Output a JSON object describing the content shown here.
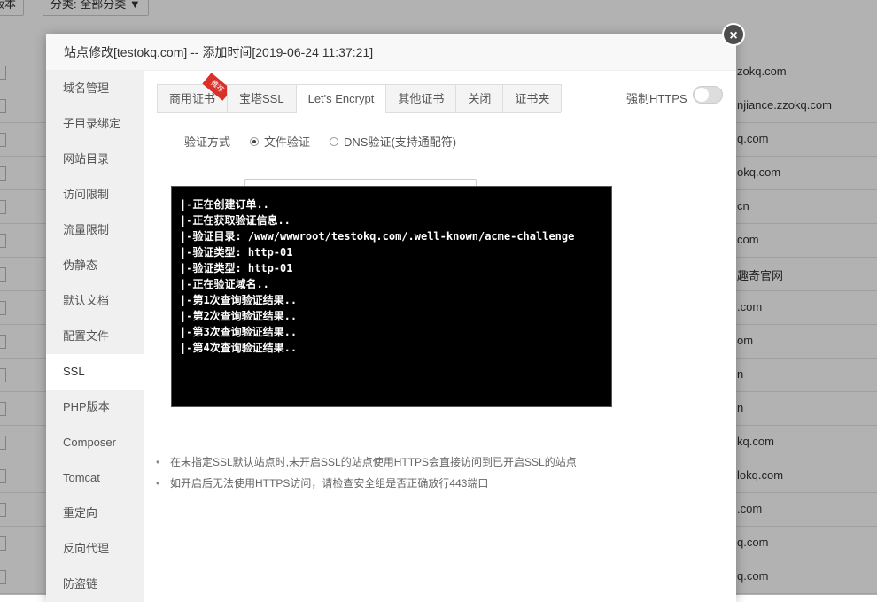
{
  "background": {
    "top_buttons": [
      "行版本",
      "分类: 全部分类 ▼"
    ],
    "row_sites": [
      "zokq.com",
      "njiance.zzokq.com",
      "q.com",
      "okq.com",
      "cn",
      "com",
      "趣奇官网",
      ".com",
      "om",
      "n",
      "n",
      "kq.com",
      "lokq.com",
      ".com",
      "q.com",
      "q.com"
    ]
  },
  "modal": {
    "title": "站点修改[testokq.com] -- 添加时间[2019-06-24 11:37:21]",
    "close_glyph": "×"
  },
  "sidebar": {
    "items": [
      "域名管理",
      "子目录绑定",
      "网站目录",
      "访问限制",
      "流量限制",
      "伪静态",
      "默认文档",
      "配置文件",
      "SSL",
      "PHP版本",
      "Composer",
      "Tomcat",
      "重定向",
      "反向代理",
      "防盗链"
    ],
    "active": "SSL"
  },
  "ssl": {
    "tabs": [
      "商用证书",
      "宝塔SSL",
      "Let's Encrypt",
      "其他证书",
      "关闭",
      "证书夹"
    ],
    "active_tab": "Let's Encrypt",
    "ribbon": "推荐",
    "force_https_label": "强制HTTPS",
    "force_https_on": false,
    "verify_label": "验证方式",
    "verify_options": [
      "文件验证",
      "DNS验证(支持通配符)"
    ],
    "verify_selected": "文件验证",
    "notes": [
      "在未指定SSL默认站点时,未开启SSL的站点使用HTTPS会直接访问到已开启SSL的站点",
      "如开启后无法使用HTTPS访问，请检查安全组是否正确放行443端口"
    ]
  },
  "terminal": {
    "lines": [
      "|-正在创建订单..",
      "|-正在获取验证信息..",
      "|-验证目录: /www/wwwroot/testokq.com/.well-known/acme-challenge",
      "|-验证类型: http-01",
      "|-验证类型: http-01",
      "|-正在验证域名..",
      "|-第1次查询验证结果..",
      "|-第2次查询验证结果..",
      "|-第3次查询验证结果..",
      "|-第4次查询验证结果.."
    ]
  },
  "colors": {
    "overlay": "rgba(0,0,0,0.3)",
    "ribbon": "#d9302a",
    "terminal_bg": "#000000"
  }
}
